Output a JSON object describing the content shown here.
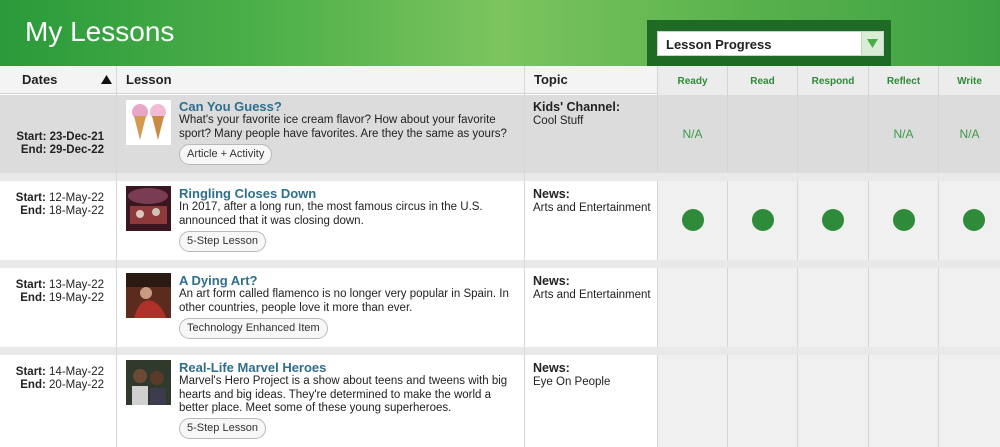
{
  "header": {
    "title": "My Lessons",
    "progress_select": {
      "value": "Lesson Progress"
    }
  },
  "columns": {
    "dates": "Dates",
    "lesson": "Lesson",
    "topic": "Topic",
    "progress": [
      "Ready",
      "Read",
      "Respond",
      "Reflect",
      "Write"
    ]
  },
  "colors": {
    "brand_green": "#2a9a3a",
    "dot_green": "#2e8b3a",
    "title_blue": "#2e6f8c"
  },
  "lessons": [
    {
      "start_label": "Start:",
      "start": "23-Dec-21",
      "end_label": "End:",
      "end": "29-Dec-22",
      "title": "Can You Guess?",
      "description": "What's your favorite ice cream flavor? How about your favorite sport? Many people have favorites. Are they the same as yours?",
      "tag": "Article + Activity",
      "topic_head": "Kids' Channel:",
      "topic_sub": "Cool Stuff",
      "thumbnail_icon": "ice-cream-image",
      "progress": [
        "N/A",
        "",
        "",
        "N/A",
        "N/A"
      ]
    },
    {
      "start_label": "Start:",
      "start": "12-May-22",
      "end_label": "End:",
      "end": "18-May-22",
      "title": "Ringling Closes Down",
      "description": "In 2017, after a long run, the most famous circus in the U.S. announced that it was closing down.",
      "tag": "5-Step Lesson",
      "topic_head": "News:",
      "topic_sub": "Arts and Entertainment",
      "thumbnail_icon": "circus-image",
      "progress": [
        "done",
        "done",
        "done",
        "done",
        "done"
      ]
    },
    {
      "start_label": "Start:",
      "start": "13-May-22",
      "end_label": "End:",
      "end": "19-May-22",
      "title": "A Dying Art?",
      "description": "An art form called flamenco is no longer very popular in Spain. In other countries, people love it more than ever.",
      "tag": "Technology Enhanced Item",
      "topic_head": "News:",
      "topic_sub": "Arts and Entertainment",
      "thumbnail_icon": "flamenco-image",
      "progress": [
        "",
        "",
        "",
        "",
        ""
      ]
    },
    {
      "start_label": "Start:",
      "start": "14-May-22",
      "end_label": "End:",
      "end": "20-May-22",
      "title": "Real-Life Marvel Heroes",
      "description": "Marvel's Hero Project is a show about teens and tweens with big hearts and big ideas. They're determined to make the world a better place. Meet some of these young superheroes.",
      "tag": "5-Step Lesson",
      "topic_head": "News:",
      "topic_sub": "Eye On People",
      "thumbnail_icon": "heroes-image",
      "progress": [
        "",
        "",
        "",
        "",
        ""
      ]
    }
  ]
}
